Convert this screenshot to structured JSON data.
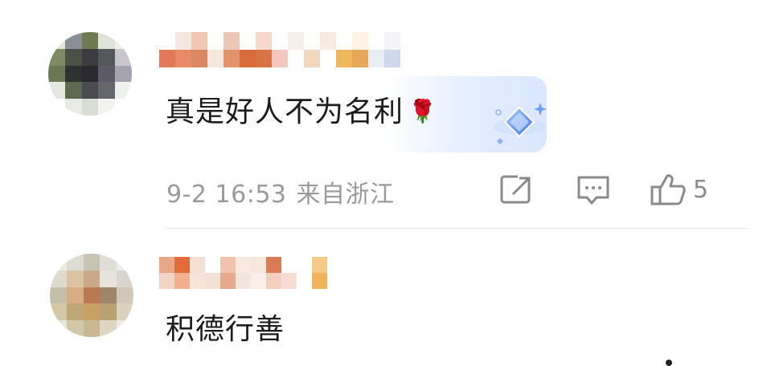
{
  "comments": [
    {
      "text": "真是好人不为名利",
      "emoji": "🌹",
      "date": "9-2 16:53",
      "location": "来自浙江",
      "likes": "5",
      "badge_icon": "diamond-badge-icon",
      "colors": {
        "bubble": "#dfe9ff",
        "badge": "#5b8ff0"
      }
    },
    {
      "text": "积德行善"
    }
  ],
  "colors": {
    "meta_text": "#9a9a9a",
    "body_text": "#1c1c1c",
    "divider": "#e6e6e6",
    "icon_stroke": "#8a8a8a"
  }
}
